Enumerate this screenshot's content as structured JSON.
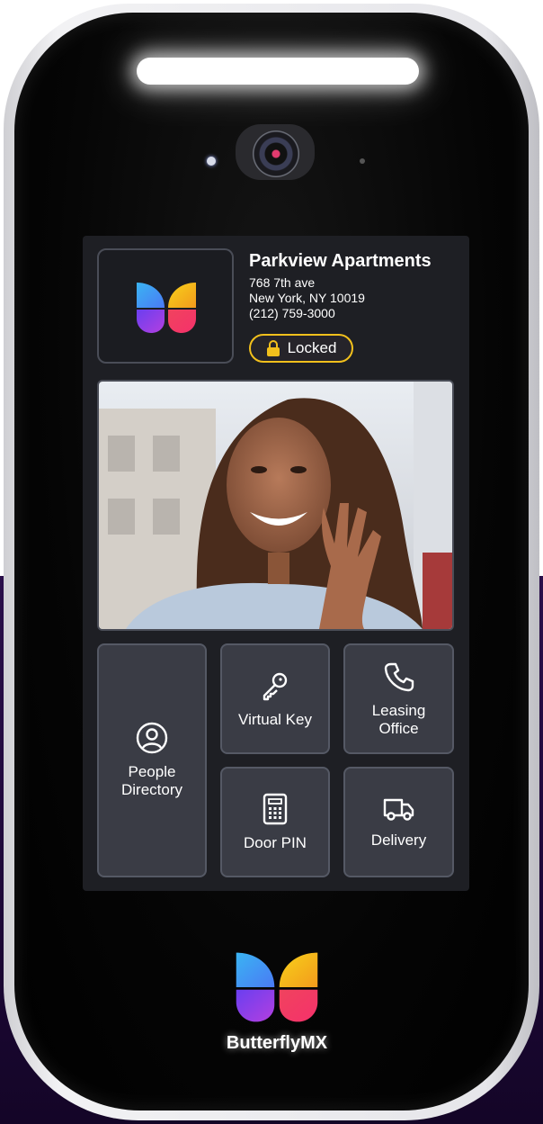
{
  "building": {
    "name": "Parkview Apartments",
    "address_line1": "768 7th ave",
    "address_line2": "New York, NY 10019",
    "phone": "(212) 759-3000"
  },
  "lock_status": {
    "label": "Locked",
    "icon": "lock-icon",
    "color": "#f2c01c"
  },
  "tiles": {
    "people_directory": {
      "label": "People\nDirectory",
      "icon": "user-circle-icon"
    },
    "virtual_key": {
      "label": "Virtual Key",
      "icon": "key-icon"
    },
    "leasing_office": {
      "label": "Leasing\nOffice",
      "icon": "phone-icon"
    },
    "door_pin": {
      "label": "Door PIN",
      "icon": "keypad-icon"
    },
    "delivery": {
      "label": "Delivery",
      "icon": "truck-icon"
    }
  },
  "brand": {
    "name": "ButterflyMX",
    "logo": "butterfly-logo"
  },
  "colors": {
    "screen_bg": "#1e1f24",
    "tile_bg": "#3a3c45",
    "accent_yellow": "#f2c01c"
  }
}
